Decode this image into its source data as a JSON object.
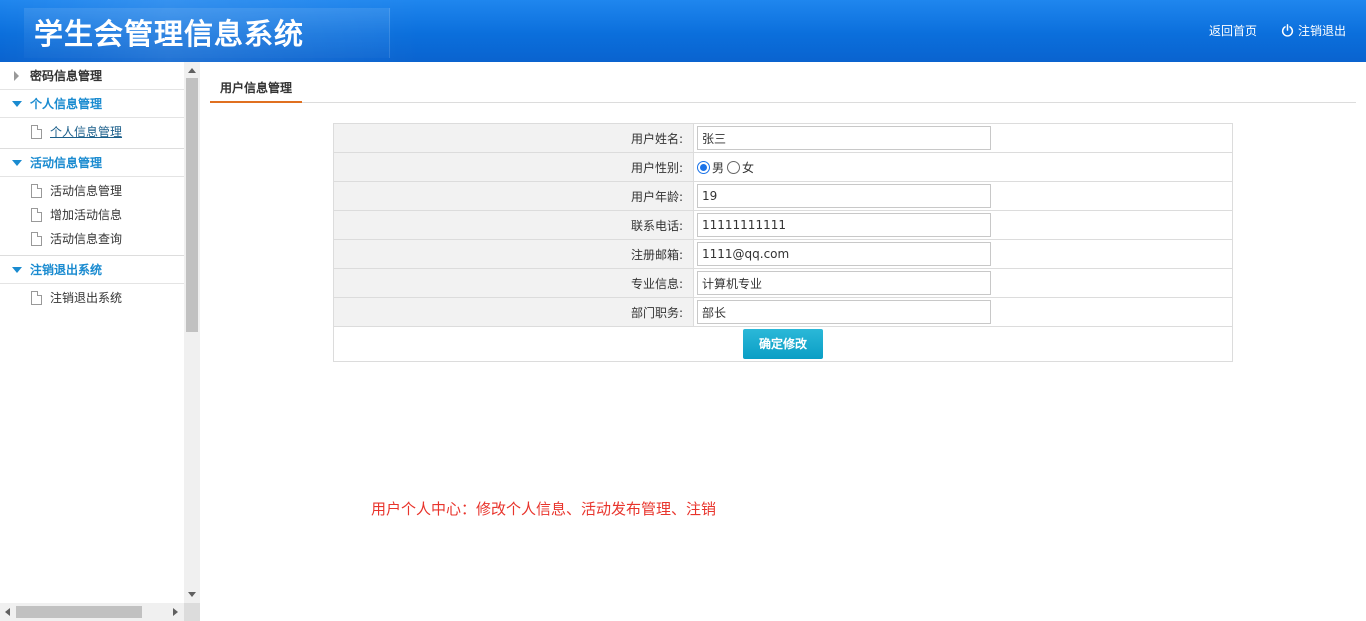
{
  "header": {
    "title": "学生会管理信息系统",
    "home_link": "返回首页",
    "logout_link": "注销退出"
  },
  "sidebar": {
    "groups": [
      {
        "label": "密码信息管理",
        "expanded": false,
        "items": []
      },
      {
        "label": "个人信息管理",
        "expanded": true,
        "items": [
          {
            "label": "个人信息管理",
            "active": true
          }
        ]
      },
      {
        "label": "活动信息管理",
        "expanded": true,
        "items": [
          {
            "label": "活动信息管理"
          },
          {
            "label": "增加活动信息"
          },
          {
            "label": "活动信息查询"
          }
        ]
      },
      {
        "label": "注销退出系统",
        "expanded": true,
        "items": [
          {
            "label": "注销退出系统"
          }
        ]
      }
    ]
  },
  "main": {
    "tab_label": "用户信息管理",
    "form": {
      "name_label": "用户姓名:",
      "name_value": "张三",
      "gender_label": "用户性别:",
      "gender_options": [
        "男",
        "女"
      ],
      "gender_selected": "男",
      "age_label": "用户年龄:",
      "age_value": "19",
      "phone_label": "联系电话:",
      "phone_value": "11111111111",
      "email_label": "注册邮箱:",
      "email_value": "1111@qq.com",
      "major_label": "专业信息:",
      "major_value": "计算机专业",
      "position_label": "部门职务:",
      "position_value": "部长",
      "submit_label": "确定修改"
    },
    "note": "用户个人中心：修改个人信息、活动发布管理、注销"
  },
  "colors": {
    "header_blue": "#0b6fdc",
    "sidebar_accent": "#1a8bd0",
    "tab_underline": "#e07020",
    "button": "#0a9ec5",
    "note_red": "#e8342c"
  }
}
